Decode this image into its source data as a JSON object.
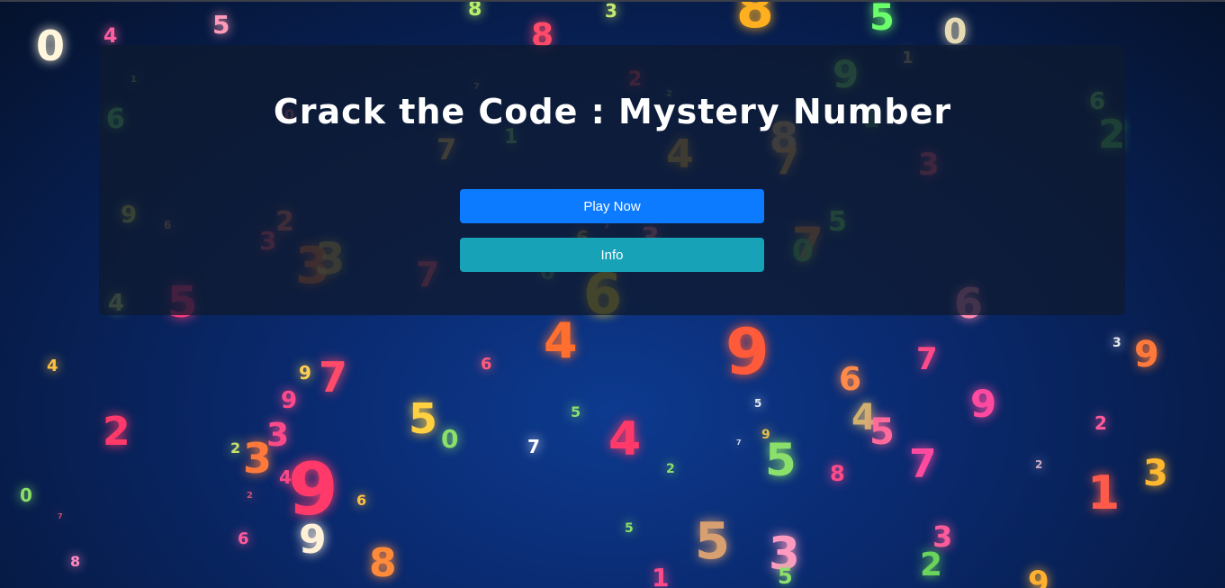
{
  "title": "Crack the Code : Mystery Number",
  "buttons": {
    "play": "Play Now",
    "info": "Info"
  },
  "colors": {
    "play_button": "#0d7bff",
    "info_button": "#17a2b8",
    "title_text": "#ffffff"
  }
}
